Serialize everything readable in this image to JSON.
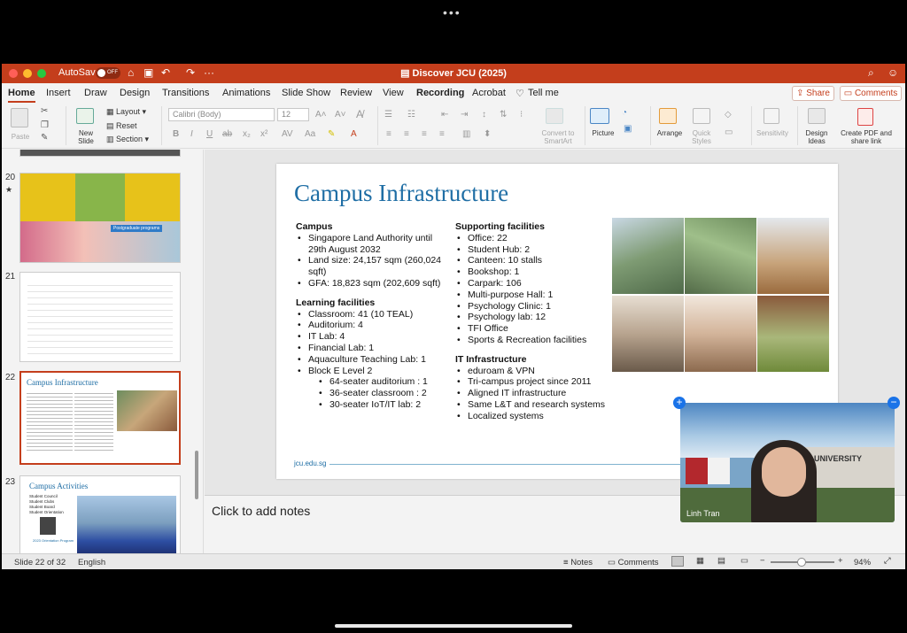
{
  "window": {
    "title": "Discover JCU (2025)",
    "autosave_label": "AutoSave",
    "autosave_state": "OFF"
  },
  "tabs": [
    "Home",
    "Insert",
    "Draw",
    "Design",
    "Transitions",
    "Animations",
    "Slide Show",
    "Review",
    "View",
    "Recording",
    "Acrobat",
    "Tell me"
  ],
  "share_label": "Share",
  "comments_label": "Comments",
  "ribbon": {
    "paste": "Paste",
    "new_slide": "New Slide",
    "layout": "Layout",
    "reset": "Reset",
    "section": "Section",
    "font_name": "Calibri (Body)",
    "font_size": "12",
    "convert_smartart": "Convert to SmartArt",
    "picture": "Picture",
    "arrange": "Arrange",
    "quick_styles": "Quick Styles",
    "sensitivity": "Sensitivity",
    "design_ideas": "Design Ideas",
    "create_pdf": "Create PDF and share link"
  },
  "thumbnails": [
    {
      "num": "20",
      "star": "★",
      "label": "Postgraduate programs"
    },
    {
      "num": "21"
    },
    {
      "num": "22",
      "title": "Campus Infrastructure"
    },
    {
      "num": "23",
      "title": "Campus Activities",
      "items": [
        "Student Council",
        "Student Clubs",
        "Student Board",
        "Student Orientation"
      ],
      "caption": "2023 Orientation Program"
    }
  ],
  "slide": {
    "title": "Campus Infrastructure",
    "campus_heading": "Campus",
    "campus_items": [
      "Singapore Land Authority until 29th August 2032",
      "Land size: 24,157 sqm (260,024 sqft)",
      "GFA: 18,823 sqm (202,609 sqft)"
    ],
    "learning_heading": "Learning facilities",
    "learning_items": [
      "Classroom: 41 (10 TEAL)",
      "Auditorium: 4",
      "IT Lab: 4",
      "Financial Lab: 1",
      "Aquaculture Teaching Lab: 1",
      "Block E Level 2"
    ],
    "blocke_items": [
      "64-seater auditorium : 1",
      "36-seater classroom : 2",
      "30-seater IoT/IT lab: 2"
    ],
    "support_heading": "Supporting facilities",
    "support_items": [
      "Office: 22",
      "Student Hub: 2",
      "Canteen: 10 stalls",
      "Bookshop: 1",
      "Carpark: 106",
      "Multi-purpose Hall: 1",
      "Psychology Clinic: 1",
      "Psychology lab: 12",
      "TFI Office",
      "Sports & Recreation facilities"
    ],
    "it_heading": "IT Infrastructure",
    "it_items": [
      "eduroam & VPN",
      "Tri-campus project since 2011",
      "Aligned IT infrastructure",
      "Same L&T and research systems",
      "Localized systems"
    ],
    "url": "jcu.edu.sg"
  },
  "notes_placeholder": "Click to add notes",
  "status": {
    "slide": "Slide 22 of 32",
    "language": "English",
    "notes": "Notes",
    "comments": "Comments",
    "zoom": "94%"
  },
  "video": {
    "name": "Linh Tran",
    "sign_text": "K UNIVERSITY"
  },
  "colors": {
    "accent": "#c43e1c",
    "slide_title": "#1f6ea5"
  }
}
